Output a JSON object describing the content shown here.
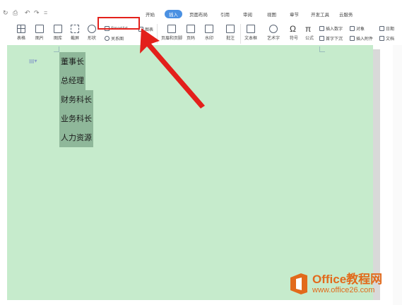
{
  "quick_access": [
    "↻",
    "⎙",
    "↶",
    "↷",
    "="
  ],
  "tabs": [
    {
      "label": "开始",
      "active": false
    },
    {
      "label": "插入",
      "active": true
    },
    {
      "label": "页面布局",
      "active": false
    },
    {
      "label": "引用",
      "active": false
    },
    {
      "label": "审阅",
      "active": false
    },
    {
      "label": "视图",
      "active": false
    },
    {
      "label": "章节",
      "active": false
    },
    {
      "label": "开发工具",
      "active": false
    },
    {
      "label": "云服务",
      "active": false
    }
  ],
  "ribbon": {
    "table": "表格",
    "picture": "图片",
    "gallery": "图库",
    "screenshot": "截屏",
    "shape": "形状",
    "smartart": "SmartArt",
    "relation": "关系图",
    "chart": "图表",
    "header_footer": "页眉和页脚",
    "page_number": "页码",
    "watermark": "水印",
    "comment": "批注",
    "textbox": "文本框",
    "wordart": "艺术字",
    "symbol": "符号",
    "formula": "公式",
    "insert_number": "插入数字",
    "object": "对象",
    "first_letter_sink": "首字下沉",
    "attachment": "插入附件",
    "date": "日期",
    "doc_part": "文档"
  },
  "document": {
    "lines": [
      "董事长",
      "总经理",
      "财务科长",
      "业务科长",
      "人力资源"
    ]
  },
  "watermark": {
    "title": "Office教程网",
    "url": "www.office26.com"
  },
  "colors": {
    "page_bg": "#c6ebcc",
    "selection": "#8fb89a",
    "accent": "#4a90e2",
    "highlight": "#e3201b",
    "brand": "#e26a1b"
  }
}
